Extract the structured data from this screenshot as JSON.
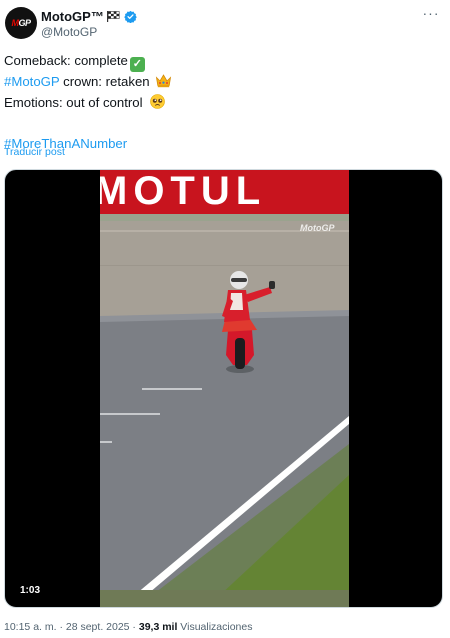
{
  "author": {
    "display_name": "MotoGP™",
    "handle": "@MotoGP",
    "avatar_text": "MotoGP",
    "flag_icon": "chequered-flag-icon",
    "verified_icon": "verified-badge-icon"
  },
  "tweet": {
    "line1_text": "Comeback: complete",
    "line2_hashtag": "#MotoGP",
    "line2_text": " crown: retaken",
    "line3_text": "Emotions: out of control",
    "line4_hashtag": "#MoreThanANumber",
    "translate": "Traducir post"
  },
  "media": {
    "duration": "1:03",
    "banner_text": "MOTUL",
    "watermark": "MotoGP"
  },
  "meta": {
    "time": "10:15 a. m.",
    "separator": " · ",
    "date": "28 sept. 2025",
    "views_count": "39,3 mil",
    "views_label": " Visualizaciones"
  },
  "colors": {
    "link": "#1d9bf0",
    "text": "#0f1419",
    "muted": "#536471",
    "banner_red": "#c8141e"
  }
}
